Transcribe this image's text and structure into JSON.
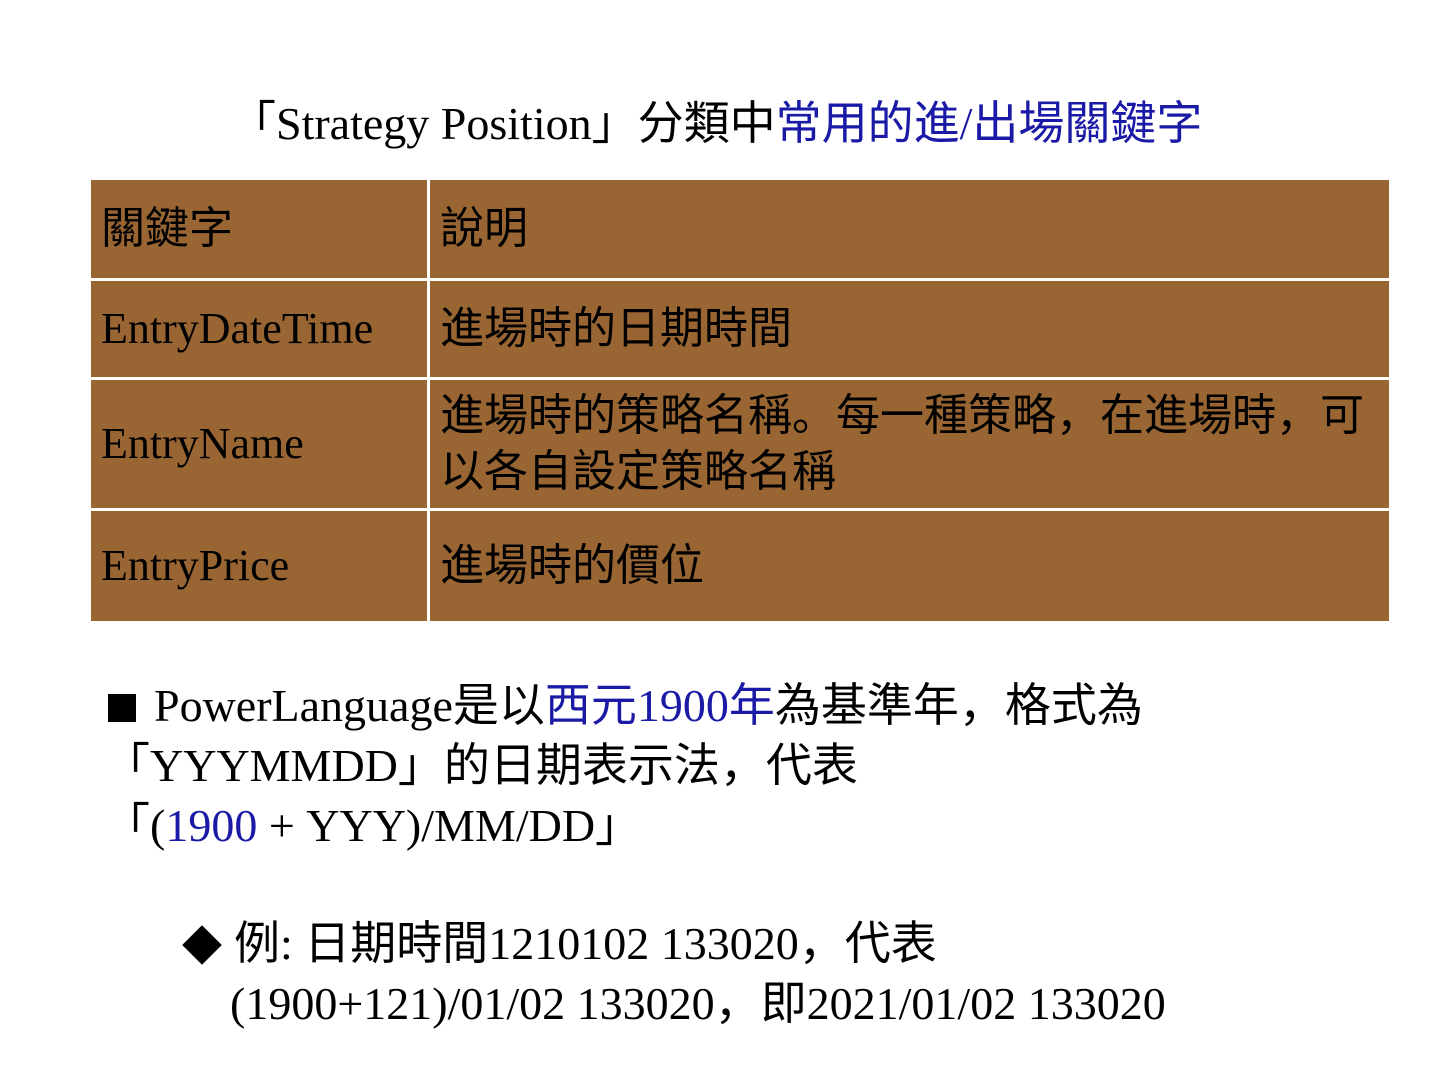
{
  "title": {
    "part1": "「Strategy Position」分類中",
    "part2": "常用的進/出場關鍵字"
  },
  "table": {
    "headers": [
      "關鍵字",
      "說明"
    ],
    "rows": [
      {
        "keyword": "EntryDateTime",
        "desc": "進場時的日期時間"
      },
      {
        "keyword": "EntryName",
        "desc": "進場時的策略名稱。每一種策略，在進場時，可以各自設定策略名稱"
      },
      {
        "keyword": "EntryPrice",
        "desc": "進場時的價位"
      }
    ]
  },
  "bullet": {
    "line1_a": "PowerLanguage是以",
    "line1_b": "西元1900年",
    "line1_c": "為基準年，格式為",
    "line2": "「YYYMMDD」的日期表示法，代表",
    "line3_a": "「(",
    "line3_b": "1900",
    "line3_c": " + YYY)/MM/DD」"
  },
  "sub_bullet": {
    "line1": "例: 日期時間1210102 133020，代表",
    "line2": "(1900+121)/01/02 133020，即2021/01/02 133020"
  },
  "colors": {
    "table_fill": "#996633",
    "accent": "#1a1aa6"
  }
}
